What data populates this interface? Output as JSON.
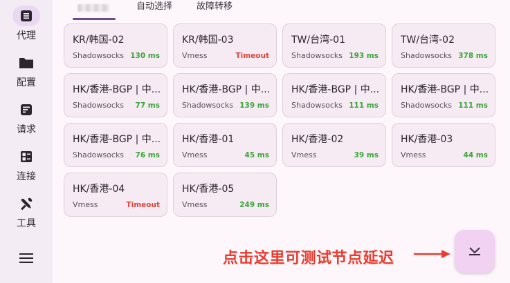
{
  "sidebar": {
    "items": [
      {
        "label": "代理",
        "icon": "proxy-icon",
        "active": true
      },
      {
        "label": "配置",
        "icon": "folder-icon",
        "active": false
      },
      {
        "label": "请求",
        "icon": "request-icon",
        "active": false
      },
      {
        "label": "连接",
        "icon": "connection-icon",
        "active": false
      },
      {
        "label": "工具",
        "icon": "tools-icon",
        "active": false
      }
    ],
    "menu_icon": "menu-icon"
  },
  "tabs": [
    {
      "label": "",
      "blurred": true,
      "active": true
    },
    {
      "label": "自动选择",
      "active": false
    },
    {
      "label": "故障转移",
      "active": false
    }
  ],
  "nodes": [
    {
      "name": "KR/韩国-02",
      "protocol": "Shadowsocks",
      "delay": "130 ms",
      "status": "ok"
    },
    {
      "name": "KR/韩国-03",
      "protocol": "Vmess",
      "delay": "Timeout",
      "status": "timeout"
    },
    {
      "name": "TW/台湾-01",
      "protocol": "Shadowsocks",
      "delay": "193 ms",
      "status": "ok"
    },
    {
      "name": "TW/台湾-02",
      "protocol": "Shadowsocks",
      "delay": "378 ms",
      "status": "ok"
    },
    {
      "name": "HK/香港-BGP | 中...",
      "protocol": "Shadowsocks",
      "delay": "77 ms",
      "status": "ok"
    },
    {
      "name": "HK/香港-BGP | 中...",
      "protocol": "Shadowsocks",
      "delay": "139 ms",
      "status": "ok"
    },
    {
      "name": "HK/香港-BGP | 中...",
      "protocol": "Shadowsocks",
      "delay": "111 ms",
      "status": "ok"
    },
    {
      "name": "HK/香港-BGP | 中...",
      "protocol": "Shadowsocks",
      "delay": "111 ms",
      "status": "ok"
    },
    {
      "name": "HK/香港-BGP | 中...",
      "protocol": "Shadowsocks",
      "delay": "76 ms",
      "status": "ok"
    },
    {
      "name": "HK/香港-01",
      "protocol": "Vmess",
      "delay": "45 ms",
      "status": "ok"
    },
    {
      "name": "HK/香港-02",
      "protocol": "Vmess",
      "delay": "39 ms",
      "status": "ok"
    },
    {
      "name": "HK/香港-03",
      "protocol": "Vmess",
      "delay": "44 ms",
      "status": "ok"
    },
    {
      "name": "HK/香港-04",
      "protocol": "Vmess",
      "delay": "Timeout",
      "status": "timeout"
    },
    {
      "name": "HK/香港-05",
      "protocol": "Vmess",
      "delay": "249 ms",
      "status": "ok"
    }
  ],
  "annotation": {
    "text": "点击这里可测试节点延迟"
  },
  "fab": {
    "icon": "latency-test-icon"
  },
  "colors": {
    "ok": "#3aa63a",
    "timeout": "#e0463a",
    "accent": "#6f4a8e",
    "annotation": "#ea3b2e"
  }
}
